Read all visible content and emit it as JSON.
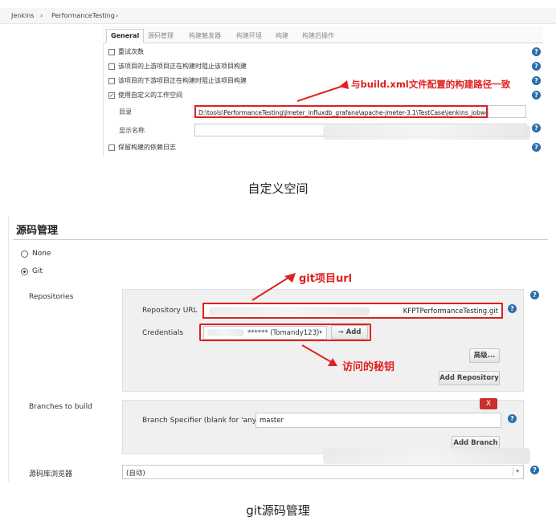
{
  "shot1": {
    "breadcrumb": [
      "Jenkins",
      "›",
      "PerformanceTesting",
      "›"
    ],
    "tabs": [
      "General",
      "源码管理",
      "构建触发器",
      "构建环境",
      "构建",
      "构建后操作"
    ],
    "options": [
      {
        "label": "重试次数",
        "checked": false
      },
      {
        "label": "该项目的上游项目正在构建时阻止该项目构建",
        "checked": false
      },
      {
        "label": "该项目的下游项目正在构建时阻止该项目构建",
        "checked": false
      },
      {
        "label": "使用自定义的工作空间",
        "checked": true
      }
    ],
    "directory_label": "目录",
    "directory_value": "D:\\tools\\PerformanceTesting\\Jmeter_influxdb_grafana\\apache-jmeter-3.1\\TestCase\\jenkins_jobworkspace",
    "display_name_label": "显示名称",
    "display_name_value": "",
    "keep_log_label": "保留构建的依赖日志",
    "annotation": "与build.xml文件配置的构建路径一致",
    "caption": "自定义空间"
  },
  "shot2": {
    "title": "源码管理",
    "scm_options": [
      {
        "label": "None",
        "selected": false
      },
      {
        "label": "Git",
        "selected": true
      }
    ],
    "repositories_label": "Repositories",
    "repo_url_label": "Repository URL",
    "repo_url_value": "KFPTPerformanceTesting.git",
    "credentials_label": "Credentials",
    "credentials_value": "****** (Tomandy123)",
    "add_button": "Add",
    "advanced_button": "高级...",
    "add_repository_button": "Add Repository",
    "branches_label": "Branches to build",
    "delete_button": "X",
    "branch_specifier_label": "Branch Specifier (blank for 'any')",
    "branch_specifier_value": "master",
    "add_branch_button": "Add Branch",
    "repo_browser_label": "源码库浏览器",
    "repo_browser_value": "(自动)",
    "annotation_url": "git项目url",
    "annotation_key": "访问的秘钥",
    "caption": "git源码管理"
  },
  "help_icon": "?",
  "colors": {
    "annotation_red": "#e02020",
    "help_blue": "#2d6dab",
    "delete_red": "#c9302c"
  }
}
